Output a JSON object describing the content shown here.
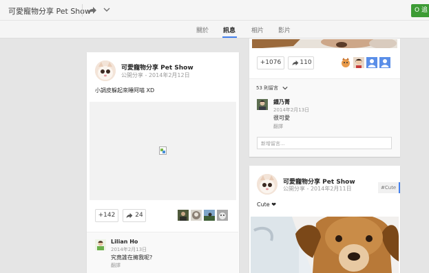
{
  "header": {
    "title": "可愛寵物分享 Pet Show",
    "follow_label": "O 追",
    "accent_color": "#3d9b35"
  },
  "tabs": [
    {
      "label": "關於"
    },
    {
      "label": "訊息"
    },
    {
      "label": "相片"
    },
    {
      "label": "影片"
    }
  ],
  "active_tab": "訊息",
  "post_left": {
    "author": "可愛寵物分享 Pet Show",
    "meta": "公開分享 - 2014年2月12日",
    "text": "小調皮躲起來睡阿喵 XD",
    "plus_label": "+142",
    "share_label": "24",
    "comment": {
      "author": "Lilian Ho",
      "date": "2014年2月13日",
      "text": "究竟誰在擁我呢?",
      "reply": "翻譯"
    }
  },
  "post_right_top": {
    "plus_label": "+1076",
    "share_label": "110",
    "comments_count_label": "53 則留言",
    "comment": {
      "author": "鍾乃菁",
      "date": "2014年2月13日",
      "text": "很可愛",
      "reply": "翻譯"
    },
    "input_placeholder": "新增留言..."
  },
  "post_right_bottom": {
    "author": "可愛寵物分享 Pet Show",
    "meta": "公開分享 - 2014年2月11日",
    "tag": "#Cute",
    "text": "Cute ❤"
  }
}
